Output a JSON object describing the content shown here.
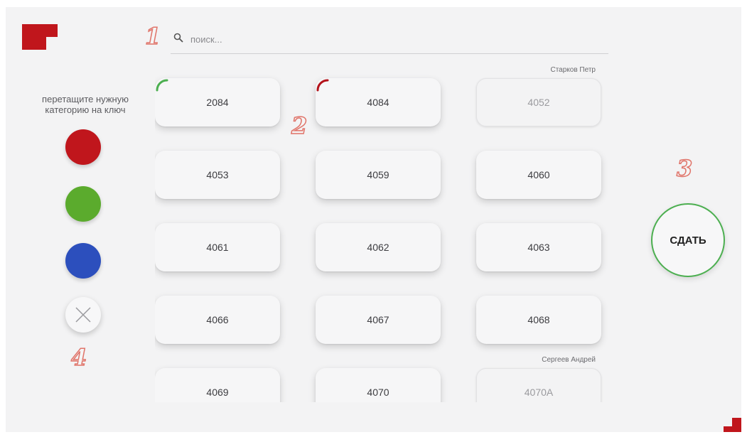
{
  "search": {
    "placeholder": "поиск...",
    "value": ""
  },
  "sidebar": {
    "instruction": "перетащите нужную категорию на ключ",
    "categories": [
      {
        "name": "red",
        "color": "#c0161c"
      },
      {
        "name": "green",
        "color": "#5bab2d"
      },
      {
        "name": "blue",
        "color": "#2c4fbd"
      }
    ]
  },
  "annotations": [
    "1",
    "2",
    "3",
    "4"
  ],
  "keys": [
    {
      "number": "2084",
      "status": "green-mark"
    },
    {
      "number": "4084",
      "status": "red-mark"
    },
    {
      "number": "4052",
      "status": "taken",
      "holder": "Старков Петр"
    },
    {
      "number": "4053"
    },
    {
      "number": "4059"
    },
    {
      "number": "4060"
    },
    {
      "number": "4061"
    },
    {
      "number": "4062"
    },
    {
      "number": "4063"
    },
    {
      "number": "4066"
    },
    {
      "number": "4067"
    },
    {
      "number": "4068"
    },
    {
      "number": "4069"
    },
    {
      "number": "4070"
    },
    {
      "number": "4070A",
      "status": "taken",
      "holder": "Сергеев Андрей"
    }
  ],
  "submit": {
    "label": "СДАТЬ"
  },
  "colors": {
    "brand": "#c0161c",
    "submit_ring": "#4caf50",
    "green_mark": "#4caf50",
    "red_mark": "#b3121a",
    "annotation": "#e0746a"
  },
  "icons": {
    "logo": "red-block-logo-icon",
    "search": "search-icon",
    "clear": "close-icon"
  }
}
